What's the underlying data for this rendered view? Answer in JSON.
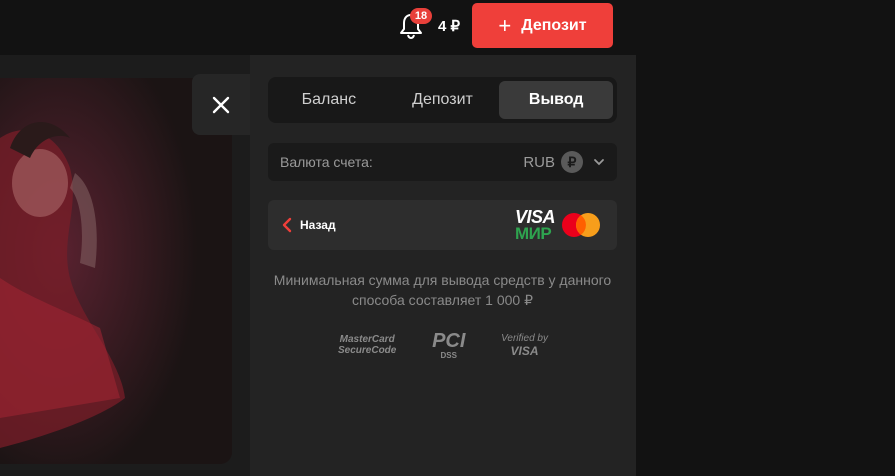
{
  "header": {
    "notifications_count": "18",
    "balance": "4 ₽",
    "deposit_button": "Депозит"
  },
  "tabs": [
    {
      "label": "Баланс",
      "active": false
    },
    {
      "label": "Депозит",
      "active": false
    },
    {
      "label": "Вывод",
      "active": true
    }
  ],
  "currency": {
    "label": "Валюта счета:",
    "code": "RUB",
    "symbol": "₽"
  },
  "back": {
    "label": "Назад"
  },
  "payment_logos": {
    "visa": "VISA",
    "mir": "МИР"
  },
  "min_amount_text": "Минимальная сумма для вывода средств у данного способа составляет 1 000 ₽",
  "security": {
    "mastercard_line1": "MasterCard",
    "mastercard_line2": "SecureCode",
    "pci": "PCI",
    "dss": "DSS",
    "verified_line1": "Verified by",
    "verified_line2": "VISA"
  },
  "colors": {
    "accent": "#ef3f3a",
    "panel": "#232323",
    "mir_green": "#2ea44f"
  }
}
